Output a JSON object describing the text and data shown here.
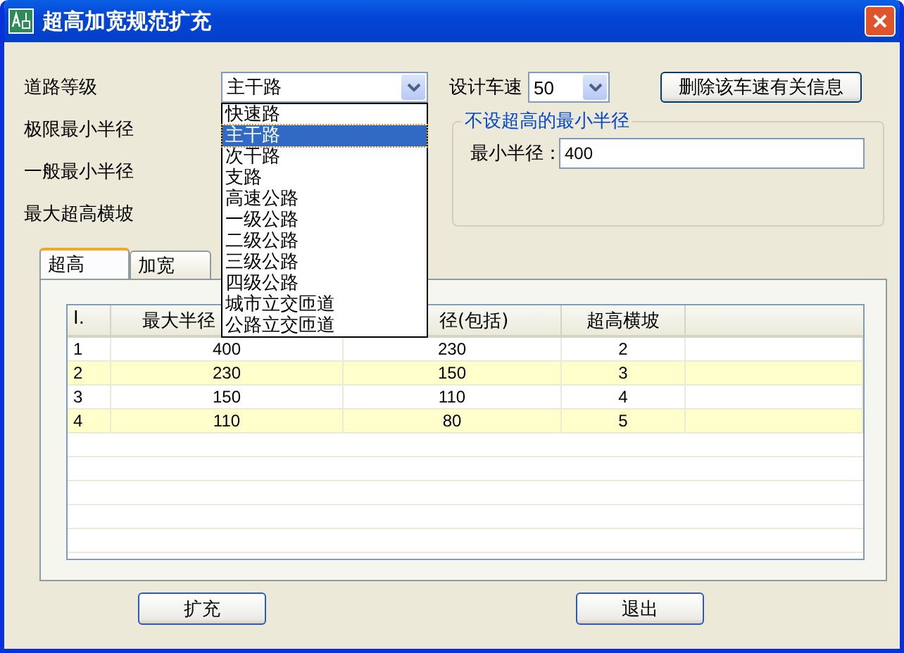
{
  "window": {
    "title": "超高加宽规范扩充"
  },
  "road_grade": {
    "label": "道路等级",
    "value": "主干路",
    "options": [
      {
        "label": "快速路",
        "selected": false
      },
      {
        "label": "主干路",
        "selected": true
      },
      {
        "label": "次干路",
        "selected": false
      },
      {
        "label": "支路",
        "selected": false
      },
      {
        "label": "高速公路",
        "selected": false
      },
      {
        "label": "一级公路",
        "selected": false
      },
      {
        "label": "二级公路",
        "selected": false
      },
      {
        "label": "三级公路",
        "selected": false
      },
      {
        "label": "四级公路",
        "selected": false
      },
      {
        "label": "城市立交匝道",
        "selected": false
      },
      {
        "label": "公路立交匝道",
        "selected": false
      }
    ]
  },
  "design_speed": {
    "label": "设计车速",
    "value": "50"
  },
  "delete_button": "删除该车速有关信息",
  "labels": [
    "极限最小半径",
    "一般最小半径",
    "最大超高横坡"
  ],
  "group": {
    "title": "不设超高的最小半径",
    "field_label": "最小半径：",
    "field_value": "400"
  },
  "tabs": [
    {
      "label": "超高",
      "selected": true
    },
    {
      "label": "加宽",
      "selected": false
    }
  ],
  "table": {
    "columns": [
      "I.",
      "最大半径",
      "径(包括)",
      "超高横坡"
    ],
    "rows": [
      {
        "cells": [
          "1",
          "400",
          "230",
          "2"
        ],
        "highlighted": false
      },
      {
        "cells": [
          "2",
          "230",
          "150",
          "3"
        ],
        "highlighted": true
      },
      {
        "cells": [
          "3",
          "150",
          "110",
          "4"
        ],
        "highlighted": false
      },
      {
        "cells": [
          "4",
          "110",
          "80",
          "5"
        ],
        "highlighted": true
      }
    ]
  },
  "buttons": [
    "扩充",
    "退出"
  ]
}
